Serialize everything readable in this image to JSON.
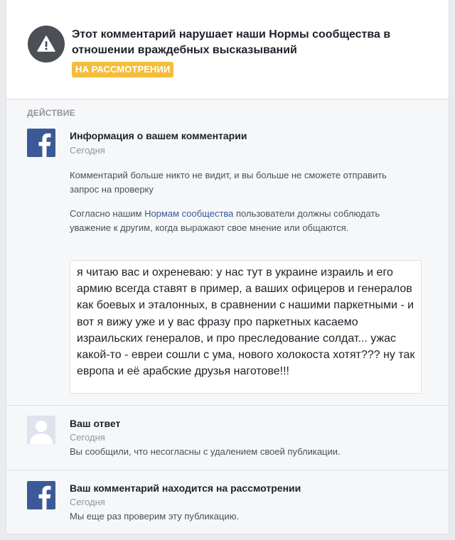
{
  "header": {
    "title": "Этот комментарий нарушает наши Нормы сообщества в отношении враждебных высказываний",
    "status_badge": "НА РАССМОТРЕНИИ",
    "icon": "warning-icon"
  },
  "section": {
    "label": "ДЕЙСТВИЕ"
  },
  "info_item": {
    "icon": "facebook-logo-icon",
    "title": "Информация о вашем комментарии",
    "date": "Сегодня",
    "paragraph1": "Комментарий больше никто не видит, и вы больше не сможете отправить запрос на проверку",
    "paragraph2_before": "Согласно нашим ",
    "paragraph2_link": "Нормам сообщества",
    "paragraph2_after": " пользователи должны соблюдать уважение к другим, когда выражают свое мнение или общаются."
  },
  "comment": {
    "text": "я читаю вас и охреневаю: у нас тут в украине израиль и его армию всегда ставят в пример, а ваших офицеров и генералов как боевых и эталонных, в сравнении с нашими паркетными - и вот я вижу уже и у вас фразу про паркетных касаемо израильских генералов, и про преследование солдат... ужас какой-то - евреи сошли с ума, нового холокоста хотят??? ну так европа и её арабские друзья наготове!!!"
  },
  "reply_item": {
    "icon": "user-avatar-icon",
    "title": "Ваш ответ",
    "date": "Сегодня",
    "text": "Вы сообщили, что несогласны с удалением своей публикации."
  },
  "review_item": {
    "icon": "facebook-logo-icon",
    "title": "Ваш комментарий находится на рассмотрении",
    "date": "Сегодня",
    "text": "Мы еще раз проверим эту публикацию."
  },
  "colors": {
    "page_bg": "#e9ebee",
    "card_bg": "#f6f7f9",
    "badge": "#f5bd3b",
    "facebook_blue": "#3b5998",
    "link": "#365899",
    "warning_circle": "#4b4f56"
  }
}
